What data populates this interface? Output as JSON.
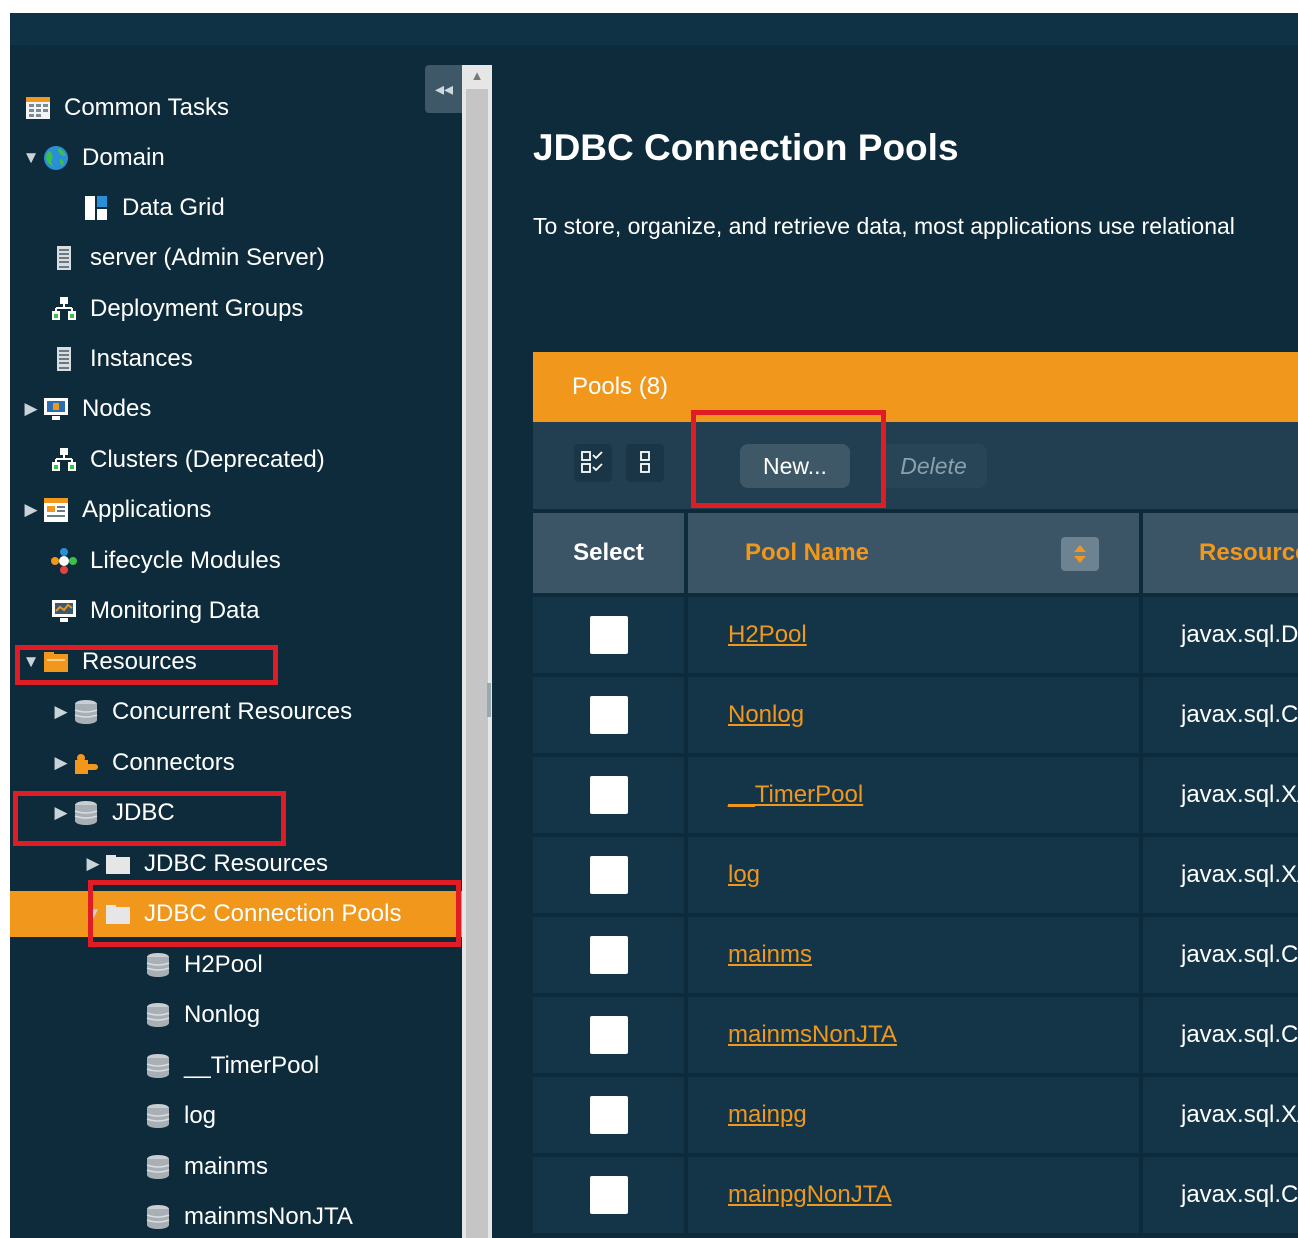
{
  "sidebar": {
    "items": [
      {
        "label": "Common Tasks",
        "icon": "common-tasks-icon",
        "arrow": ""
      },
      {
        "label": "Domain",
        "icon": "globe-icon",
        "arrow": "▼"
      },
      {
        "label": "Data Grid",
        "icon": "data-grid-icon",
        "arrow": ""
      },
      {
        "label": "server (Admin Server)",
        "icon": "server-icon",
        "arrow": ""
      },
      {
        "label": "Deployment Groups",
        "icon": "group-icon",
        "arrow": ""
      },
      {
        "label": "Instances",
        "icon": "server-icon",
        "arrow": ""
      },
      {
        "label": "Nodes",
        "icon": "monitor-icon",
        "arrow": "▶"
      },
      {
        "label": "Clusters (Deprecated)",
        "icon": "group-icon",
        "arrow": ""
      },
      {
        "label": "Applications",
        "icon": "applications-icon",
        "arrow": "▶"
      },
      {
        "label": "Lifecycle Modules",
        "icon": "lifecycle-icon",
        "arrow": ""
      },
      {
        "label": "Monitoring Data",
        "icon": "monitoring-icon",
        "arrow": ""
      },
      {
        "label": "Resources",
        "icon": "resources-folder-icon",
        "arrow": "▼"
      },
      {
        "label": "Concurrent Resources",
        "icon": "database-icon",
        "arrow": "▶"
      },
      {
        "label": "Connectors",
        "icon": "puzzle-icon",
        "arrow": "▶"
      },
      {
        "label": "JDBC",
        "icon": "database-icon",
        "arrow": "▶"
      },
      {
        "label": "JDBC Resources",
        "icon": "folder-icon",
        "arrow": "▶"
      },
      {
        "label": "JDBC Connection Pools",
        "icon": "folder-icon",
        "arrow": "▼",
        "selected": true
      },
      {
        "label": "H2Pool",
        "icon": "database-icon",
        "arrow": ""
      },
      {
        "label": "Nonlog",
        "icon": "database-icon",
        "arrow": ""
      },
      {
        "label": "__TimerPool",
        "icon": "database-icon",
        "arrow": ""
      },
      {
        "label": "log",
        "icon": "database-icon",
        "arrow": ""
      },
      {
        "label": "mainms",
        "icon": "database-icon",
        "arrow": ""
      },
      {
        "label": "mainmsNonJTA",
        "icon": "database-icon",
        "arrow": ""
      }
    ],
    "collapse_glyph": "◂◂",
    "scroll_up_glyph": "▲"
  },
  "main": {
    "title": "JDBC Connection Pools",
    "description": "To store, organize, and retrieve data, most applications use relational",
    "table": {
      "header": "Pools (8)",
      "new_label": "New...",
      "delete_label": "Delete",
      "columns": {
        "select": "Select",
        "name": "Pool Name",
        "resource": "Resource"
      },
      "rows": [
        {
          "name": "H2Pool",
          "resource": "javax.sql.DataSource"
        },
        {
          "name": "Nonlog",
          "resource": "javax.sql.ConnectionPoolDataSource"
        },
        {
          "name": "__TimerPool",
          "resource": "javax.sql.XADataSource"
        },
        {
          "name": "log",
          "resource": "javax.sql.XADataSource"
        },
        {
          "name": "mainms",
          "resource": "javax.sql.ConnectionPoolDataSource"
        },
        {
          "name": "mainmsNonJTA",
          "resource": "javax.sql.ConnectionPoolDataSource"
        },
        {
          "name": "mainpg",
          "resource": "javax.sql.XADataSource"
        },
        {
          "name": "mainpgNonJTA",
          "resource": "javax.sql.ConnectionPoolDataSource"
        }
      ]
    }
  },
  "colors": {
    "background": "#0d2b3b",
    "accent": "#f0971c",
    "highlight": "#e01c24"
  }
}
